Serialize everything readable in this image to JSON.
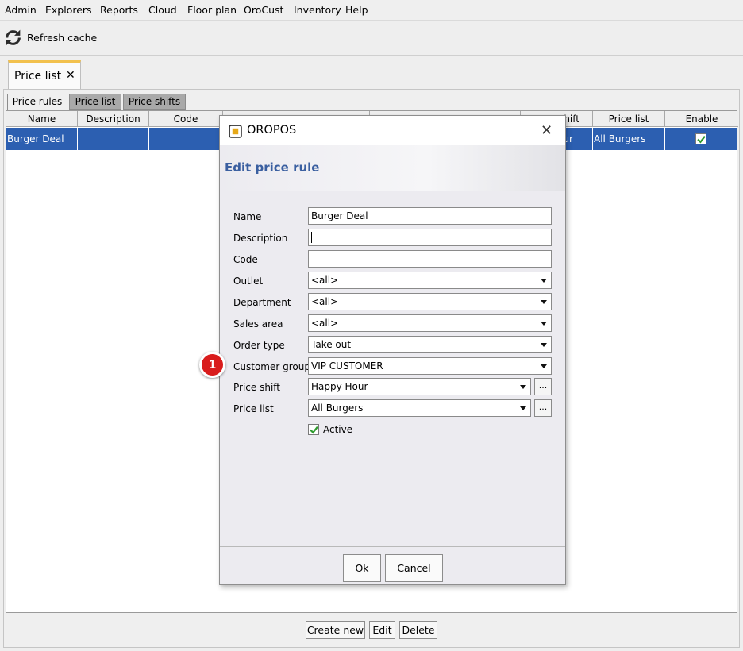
{
  "menu": [
    "Admin",
    "Explorers",
    "Reports",
    "Cloud",
    "Floor plan",
    "OroCust",
    "Inventory",
    "Help"
  ],
  "toolbar": {
    "refresh_label": "Refresh cache",
    "icon": "refresh-icon"
  },
  "main_tab": {
    "label": "Price list",
    "close": "✕"
  },
  "sub_tabs": [
    "Price rules",
    "Price list",
    "Price shifts"
  ],
  "table": {
    "columns": [
      "Name",
      "Description",
      "Code",
      "",
      "",
      "",
      "Price shift",
      "Price list",
      "Enable"
    ],
    "visible_headers": {
      "name": "Name",
      "description": "Description",
      "code": "Code",
      "shift_partial": "hift",
      "price_list": "Price list",
      "enable": "Enable"
    },
    "rows": [
      {
        "name": "Burger Deal",
        "description": "",
        "code": "",
        "shift_partial": "ur",
        "price_list": "All Burgers",
        "enable": true
      }
    ]
  },
  "bottom_buttons": {
    "create": "Create new",
    "edit": "Edit",
    "delete": "Delete"
  },
  "dialog": {
    "title": "OROPOS",
    "heading": "Edit price rule",
    "fields": {
      "name": {
        "label": "Name",
        "value": "Burger Deal"
      },
      "description": {
        "label": "Description",
        "value": ""
      },
      "code": {
        "label": "Code",
        "value": ""
      },
      "outlet": {
        "label": "Outlet",
        "value": "<all>"
      },
      "department": {
        "label": "Department",
        "value": "<all>"
      },
      "sales_area": {
        "label": "Sales area",
        "value": "<all>"
      },
      "order_type": {
        "label": "Order type",
        "value": "Take out"
      },
      "customer_group": {
        "label": "Customer group",
        "value": "VIP CUSTOMER"
      },
      "price_shift": {
        "label": "Price shift",
        "value": "Happy Hour"
      },
      "price_list": {
        "label": "Price list",
        "value": "All Burgers"
      }
    },
    "browse_label": "...",
    "active": {
      "label": "Active",
      "checked": true
    },
    "ok": "Ok",
    "cancel": "Cancel"
  },
  "annotation": {
    "number": "1",
    "color": "#d91c1c"
  },
  "colors": {
    "selection": "#2c5fb1",
    "heading": "#3a5fa0",
    "tab_accent": "#f2c14e",
    "check": "#2e9b2e"
  }
}
